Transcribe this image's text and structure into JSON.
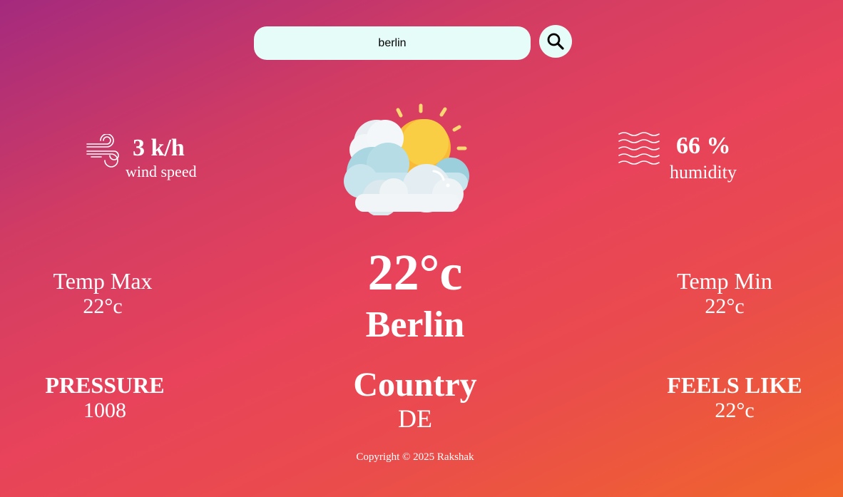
{
  "search": {
    "value": "berlin",
    "icon": "search-icon"
  },
  "wind": {
    "value": "3 k/h",
    "label": "wind speed",
    "icon": "wind-icon"
  },
  "humidity": {
    "value": "66 %",
    "label": "humidity",
    "icon": "wave-icon"
  },
  "weather": {
    "icon": "partly-cloudy-icon",
    "temperature": "22°c",
    "city": "Berlin",
    "country_label": "Country",
    "country_code": "DE"
  },
  "temp_max": {
    "label": "Temp Max",
    "value": "22°c"
  },
  "temp_min": {
    "label": "Temp Min",
    "value": "22°c"
  },
  "pressure": {
    "label": "PRESSURE",
    "value": "1008"
  },
  "feels_like": {
    "label": "FEELS LIKE",
    "value": "22°c"
  },
  "footer": {
    "copyright": "Copyright © 2025 Rakshak"
  },
  "colors": {
    "gradient_start": "#a42a7e",
    "gradient_mid": "#e8435a",
    "gradient_end": "#f0652c",
    "input_bg": "#e6fcf8",
    "text": "#ffffff"
  }
}
